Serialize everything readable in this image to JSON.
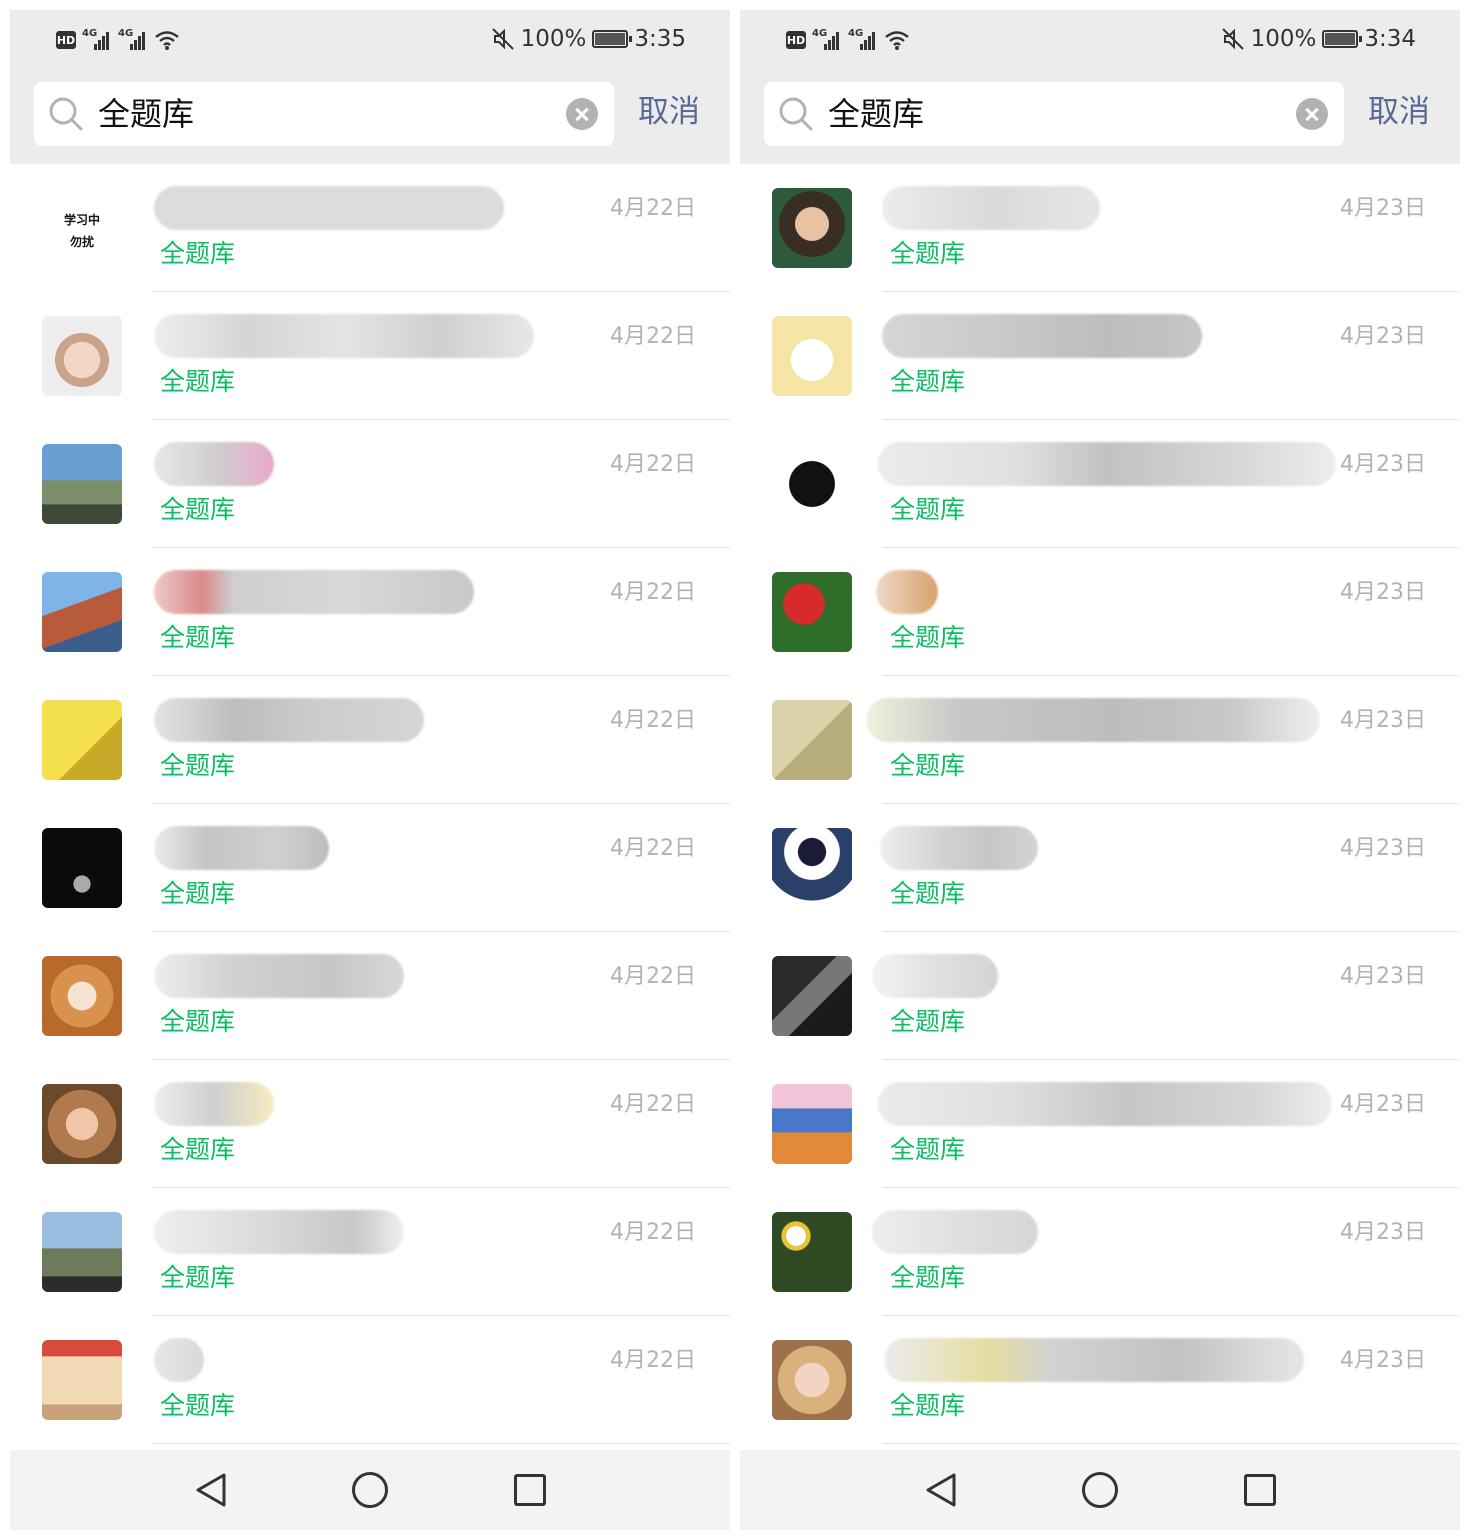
{
  "screens": [
    {
      "status": {
        "hd": "HD",
        "net1": "4G",
        "net2": "4G",
        "battery_pct": "100%",
        "time": "3:35"
      },
      "search": {
        "query": "全题库",
        "cancel": "取消"
      },
      "results": [
        {
          "avatar": "学习中勿扰",
          "keyword": "全题库",
          "date": "4月22日"
        },
        {
          "avatar": "puppy-photo",
          "keyword": "全题库",
          "date": "4月22日"
        },
        {
          "avatar": "mountain-photo",
          "keyword": "全题库",
          "date": "4月22日"
        },
        {
          "avatar": "temple-photo",
          "keyword": "全题库",
          "date": "4月22日"
        },
        {
          "avatar": "bamboo-photo",
          "keyword": "全题库",
          "date": "4月22日"
        },
        {
          "avatar": "dark-hand-photo",
          "keyword": "全题库",
          "date": "4月22日"
        },
        {
          "avatar": "corgi-photo",
          "keyword": "全题库",
          "date": "4月22日"
        },
        {
          "avatar": "girl-photo",
          "keyword": "全题库",
          "date": "4月22日"
        },
        {
          "avatar": "hiker-photo",
          "keyword": "全题库",
          "date": "4月22日"
        },
        {
          "avatar": "poster-photo",
          "keyword": "全题库",
          "date": "4月22日"
        }
      ]
    },
    {
      "status": {
        "hd": "HD",
        "net1": "4G",
        "net2": "4G",
        "battery_pct": "100%",
        "time": "3:34"
      },
      "search": {
        "query": "全题库",
        "cancel": "取消"
      },
      "results": [
        {
          "avatar": "woman-heart-photo",
          "keyword": "全题库",
          "date": "4月23日"
        },
        {
          "avatar": "cat-cartoon",
          "keyword": "全题库",
          "date": "4月23日"
        },
        {
          "avatar": "masked-cartoon",
          "keyword": "全题库",
          "date": "4月23日"
        },
        {
          "avatar": "red-flowers-photo",
          "keyword": "全题库",
          "date": "4月23日"
        },
        {
          "avatar": "guitarist-sketch",
          "keyword": "全题库",
          "date": "4月23日"
        },
        {
          "avatar": "scarf-boy-cartoon",
          "keyword": "全题库",
          "date": "4月23日"
        },
        {
          "avatar": "band-photo",
          "keyword": "全题库",
          "date": "4月23日"
        },
        {
          "avatar": "vase-painting",
          "keyword": "全题库",
          "date": "4月23日"
        },
        {
          "avatar": "daisies-photo",
          "keyword": "全题库",
          "date": "4月23日"
        },
        {
          "avatar": "blonde-girl-photo",
          "keyword": "全题库",
          "date": "4月23日"
        }
      ]
    }
  ],
  "colors": {
    "keyword": "#07c160",
    "cancel": "#576b95",
    "date": "#b2b2b2",
    "bar_bg": "#ececec"
  }
}
